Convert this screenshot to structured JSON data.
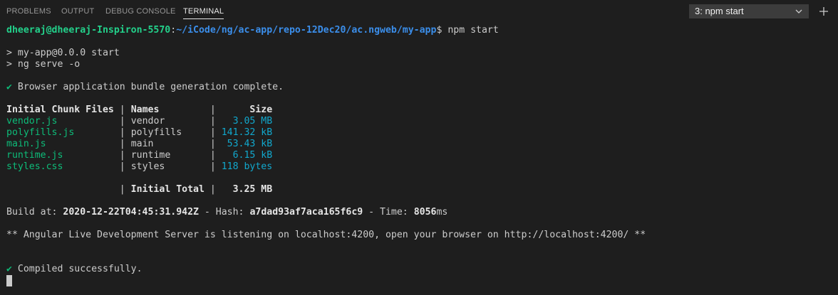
{
  "tabs": [
    "PROBLEMS",
    "OUTPUT",
    "DEBUG CONSOLE",
    "TERMINAL"
  ],
  "terminal_select": {
    "selected": "3: npm start"
  },
  "icons": {
    "dropdown": "chevron-down-icon",
    "new_terminal": "plus-icon"
  },
  "colors": {
    "background": "#1e1e1e",
    "green": "#0dbc79",
    "bright_green": "#23d18b",
    "blue": "#3b8eea",
    "cyan": "#11a8cd"
  },
  "prompt": {
    "user_host": "dheeraj@dheeraj-Inspiron-5570",
    "sep": ":",
    "path": "~/iCode/ng/ac-app/repo-12Dec20/ac.ngweb/my-app",
    "dollar": "$",
    "command": " npm start"
  },
  "script_lines": [
    "> my-app@0.0.0 start",
    "> ng serve -o"
  ],
  "bundle_msg": {
    "check": "✔",
    "text": " Browser application bundle generation complete."
  },
  "chunk_table": {
    "headers": {
      "files": "Initial Chunk Files",
      "names": "Names",
      "size": "Size"
    },
    "rows": [
      {
        "file": "vendor.js",
        "name": "vendor",
        "size": "3.05 MB"
      },
      {
        "file": "polyfills.js",
        "name": "polyfills",
        "size": "141.32 kB"
      },
      {
        "file": "main.js",
        "name": "main",
        "size": "53.43 kB"
      },
      {
        "file": "runtime.js",
        "name": "runtime",
        "size": "6.15 kB"
      },
      {
        "file": "styles.css",
        "name": "styles",
        "size": "118 bytes"
      }
    ],
    "total_label": "Initial Total",
    "total_size": "3.25 MB"
  },
  "build": {
    "at_label": "Build at: ",
    "at_value": "2020-12-22T04:45:31.942Z",
    "hash_label": " - Hash: ",
    "hash_value": "a7dad93af7aca165f6c9",
    "time_label": " - Time: ",
    "time_value": "8056",
    "time_unit": "ms"
  },
  "server_msg": "** Angular Live Development Server is listening on localhost:4200, open your browser on http://localhost:4200/ **",
  "compiled": {
    "check": "✔",
    "text": " Compiled successfully."
  }
}
